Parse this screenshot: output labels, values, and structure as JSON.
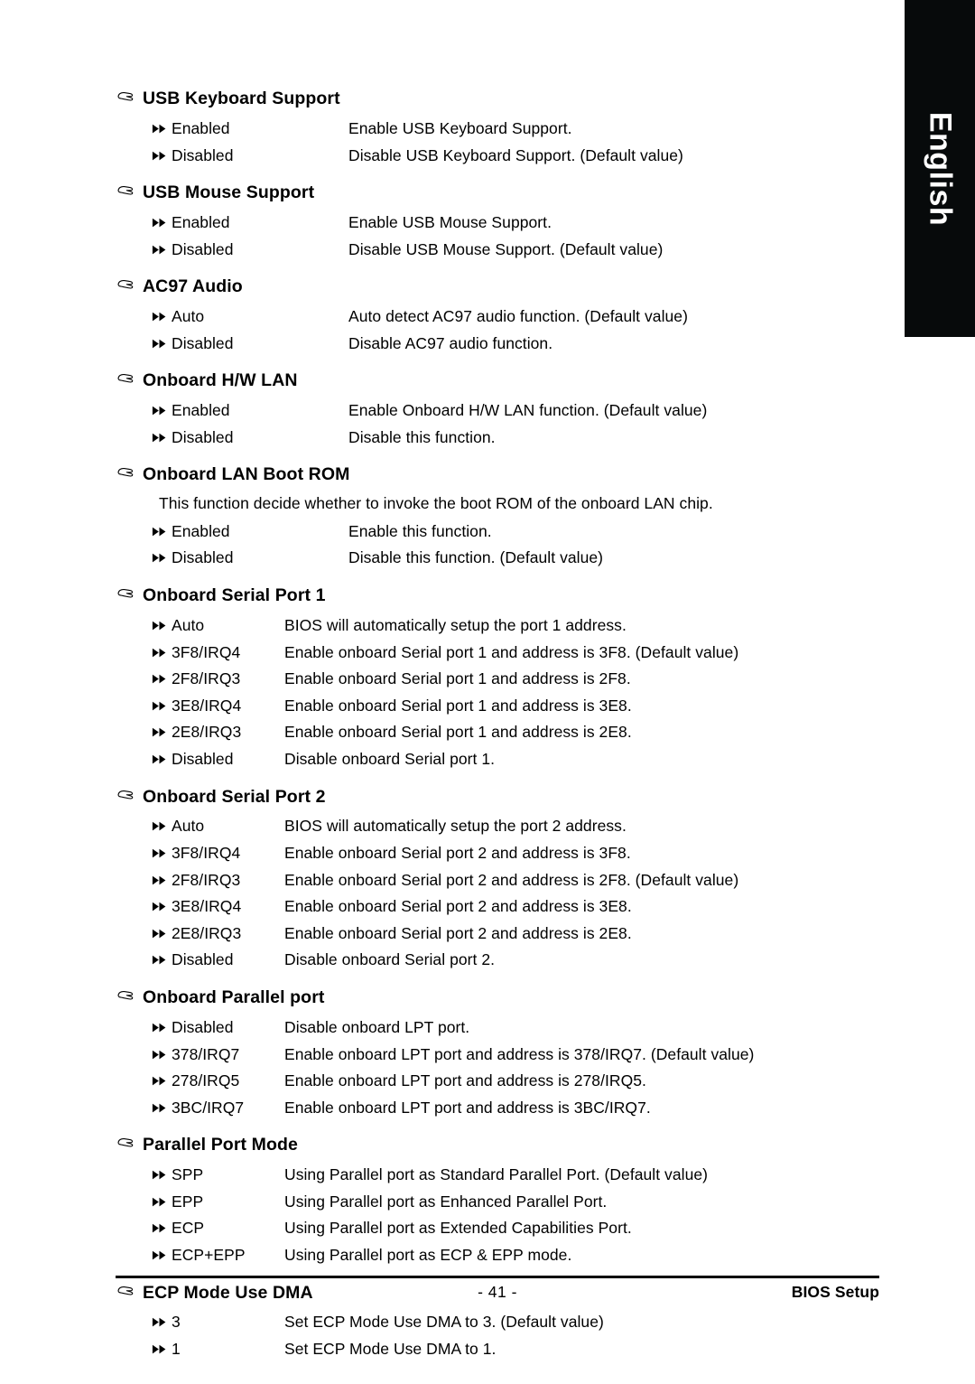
{
  "language_tab": {
    "label": "English",
    "background_color": "#070a0b",
    "text_color": "#ffffff"
  },
  "icons": {
    "section_marker": "pointing-hand-icon",
    "option_marker": "double-right-arrow-icon"
  },
  "sections": [
    {
      "title": "USB Keyboard Support",
      "column_style": "wide",
      "note": null,
      "options": [
        {
          "label": "Enabled",
          "desc": "Enable USB Keyboard Support."
        },
        {
          "label": "Disabled",
          "desc": "Disable USB Keyboard Support. (Default value)"
        }
      ]
    },
    {
      "title": "USB Mouse Support",
      "column_style": "wide",
      "note": null,
      "options": [
        {
          "label": "Enabled",
          "desc": "Enable USB Mouse Support."
        },
        {
          "label": "Disabled",
          "desc": "Disable USB Mouse Support. (Default value)"
        }
      ]
    },
    {
      "title": "AC97 Audio",
      "column_style": "wide",
      "note": null,
      "options": [
        {
          "label": "Auto",
          "desc": "Auto detect AC97 audio function. (Default value)"
        },
        {
          "label": "Disabled",
          "desc": "Disable AC97 audio function."
        }
      ]
    },
    {
      "title": "Onboard H/W LAN",
      "column_style": "wide",
      "note": null,
      "options": [
        {
          "label": "Enabled",
          "desc": "Enable Onboard H/W LAN function. (Default value)"
        },
        {
          "label": "Disabled",
          "desc": "Disable this function."
        }
      ]
    },
    {
      "title": "Onboard LAN Boot ROM",
      "column_style": "wide",
      "note": "This function decide whether to invoke the boot ROM of the onboard LAN chip.",
      "options": [
        {
          "label": "Enabled",
          "desc": "Enable this function."
        },
        {
          "label": "Disabled",
          "desc": "Disable this function. (Default value)"
        }
      ]
    },
    {
      "title": "Onboard Serial Port 1",
      "column_style": "narrow",
      "note": null,
      "options": [
        {
          "label": "Auto",
          "desc": "BIOS will automatically setup the port 1 address."
        },
        {
          "label": "3F8/IRQ4",
          "desc": "Enable onboard Serial port 1 and address is 3F8. (Default value)"
        },
        {
          "label": "2F8/IRQ3",
          "desc": "Enable onboard Serial port 1 and address is 2F8."
        },
        {
          "label": "3E8/IRQ4",
          "desc": "Enable onboard Serial port 1 and address is 3E8."
        },
        {
          "label": "2E8/IRQ3",
          "desc": "Enable onboard Serial port 1 and address is 2E8."
        },
        {
          "label": "Disabled",
          "desc": "Disable onboard Serial port 1."
        }
      ]
    },
    {
      "title": "Onboard Serial Port 2",
      "column_style": "narrow",
      "note": null,
      "options": [
        {
          "label": "Auto",
          "desc": "BIOS will automatically setup the port 2 address."
        },
        {
          "label": "3F8/IRQ4",
          "desc": "Enable onboard Serial port 2 and address is 3F8."
        },
        {
          "label": "2F8/IRQ3",
          "desc": "Enable onboard Serial port 2 and address is 2F8. (Default value)"
        },
        {
          "label": "3E8/IRQ4",
          "desc": "Enable onboard Serial port 2 and address is 3E8."
        },
        {
          "label": "2E8/IRQ3",
          "desc": "Enable onboard Serial port 2 and address is 2E8."
        },
        {
          "label": "Disabled",
          "desc": "Disable onboard Serial port 2."
        }
      ]
    },
    {
      "title": "Onboard Parallel port",
      "column_style": "narrow",
      "note": null,
      "options": [
        {
          "label": "Disabled",
          "desc": "Disable onboard LPT port."
        },
        {
          "label": "378/IRQ7",
          "desc": "Enable onboard LPT port and address is 378/IRQ7. (Default value)"
        },
        {
          "label": "278/IRQ5",
          "desc": "Enable onboard LPT port and address is 278/IRQ5."
        },
        {
          "label": "3BC/IRQ7",
          "desc": "Enable onboard LPT port and address is 3BC/IRQ7."
        }
      ]
    },
    {
      "title": "Parallel Port Mode",
      "column_style": "narrow",
      "note": null,
      "options": [
        {
          "label": "SPP",
          "desc": "Using Parallel port as Standard Parallel Port. (Default value)"
        },
        {
          "label": "EPP",
          "desc": "Using Parallel port as Enhanced Parallel Port."
        },
        {
          "label": "ECP",
          "desc": "Using Parallel port as Extended Capabilities Port."
        },
        {
          "label": "ECP+EPP",
          "desc": "Using Parallel port as ECP & EPP mode."
        }
      ]
    },
    {
      "title": "ECP Mode Use DMA",
      "column_style": "narrow",
      "note": null,
      "options": [
        {
          "label": "3",
          "desc": "Set ECP Mode Use DMA to 3. (Default value)"
        },
        {
          "label": "1",
          "desc": "Set ECP Mode Use DMA to 1."
        }
      ]
    }
  ],
  "footer": {
    "page_number": "- 41 -",
    "right_label": "BIOS Setup"
  }
}
